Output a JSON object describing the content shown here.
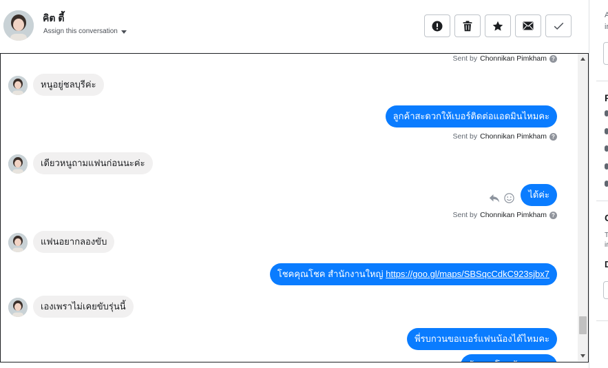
{
  "header": {
    "contact_name": "คิต ตี้",
    "assign_label": "Assign this conversation"
  },
  "actions": [
    {
      "name": "mark-spam-button",
      "icon": "exclamation-circle-icon"
    },
    {
      "name": "delete-button",
      "icon": "trash-icon"
    },
    {
      "name": "star-button",
      "icon": "star-icon"
    },
    {
      "name": "mark-unread-button",
      "icon": "envelope-icon"
    },
    {
      "name": "mark-done-button",
      "icon": "checkmark-icon"
    }
  ],
  "sent_by": {
    "prefix": "Sent by",
    "name": "Chonnikan Pimkham"
  },
  "messages": [
    {
      "dir": "in",
      "text": "หนูอยู่ชลบุรีค่ะ"
    },
    {
      "dir": "out",
      "text": "ลูกค้าสะดวกให้เบอร์ติดต่อแอดมินไหมคะ"
    },
    {
      "dir": "in",
      "text": "เดียวหนูถามแฟนก่อนนะค่ะ"
    },
    {
      "dir": "out",
      "text": "ได้ค่ะ"
    },
    {
      "dir": "in",
      "text": "แฟนอยากลองขับ"
    },
    {
      "dir": "out",
      "text_prefix": "โชคคุณโชค สำนักงานใหญ่ ",
      "link": "https://goo.gl/maps/SBSqcCdkC923sjbx7"
    },
    {
      "dir": "in",
      "text": "เองเพราไม่เคยขับรุ่นนี้"
    },
    {
      "dir": "out",
      "text": "พี่รบกวนขอเบอร์แฟนน้องได้ไหมคะ"
    },
    {
      "dir": "out",
      "text": "ต้องขอโทษด้วยนะคะ"
    }
  ],
  "right_panel": {
    "a1": "A",
    "a2": "ir",
    "section1": "P",
    "section2": "C",
    "t1": "T",
    "t2": "ir",
    "section3": "D"
  },
  "colors": {
    "outgoing_bubble": "#0a7cff",
    "incoming_bubble": "#f1f0f0"
  }
}
